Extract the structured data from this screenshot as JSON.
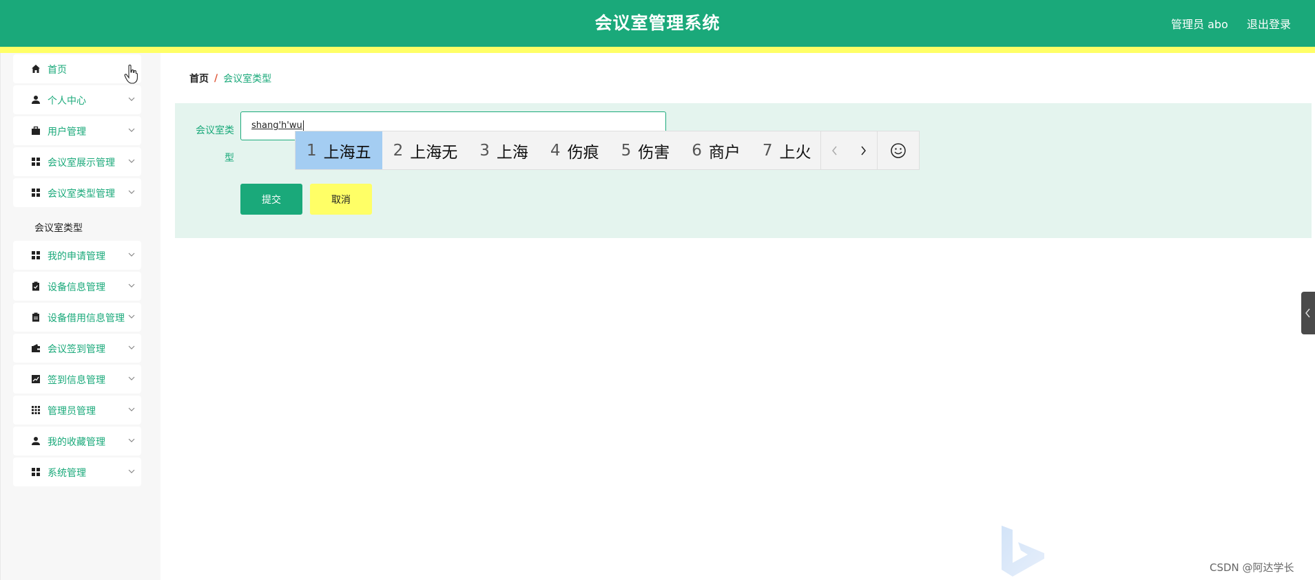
{
  "header": {
    "title": "会议室管理系统",
    "user_label": "管理员 abo",
    "logout_label": "退出登录",
    "bg_color": "#1aa97a",
    "stripe_color": "#ffff66"
  },
  "sidebar": {
    "items": [
      {
        "label": "首页",
        "icon": "home-icon"
      },
      {
        "label": "个人中心",
        "icon": "user-icon"
      },
      {
        "label": "用户管理",
        "icon": "briefcase-icon"
      },
      {
        "label": "会议室展示管理",
        "icon": "grid-icon"
      },
      {
        "label": "会议室类型管理",
        "icon": "grid-icon"
      },
      {
        "label": "我的申请管理",
        "icon": "grid-icon"
      },
      {
        "label": "设备信息管理",
        "icon": "clipboard-check-icon"
      },
      {
        "label": "设备借用信息管理",
        "icon": "clipboard-icon"
      },
      {
        "label": "会议签到管理",
        "icon": "wallet-icon"
      },
      {
        "label": "签到信息管理",
        "icon": "chart-icon"
      },
      {
        "label": "管理员管理",
        "icon": "apps-icon"
      },
      {
        "label": "我的收藏管理",
        "icon": "user-tie-icon"
      },
      {
        "label": "系统管理",
        "icon": "grid-icon"
      }
    ],
    "sub_item": "会议室类型"
  },
  "breadcrumb": {
    "home": "首页",
    "separator": "/",
    "current": "会议室类型"
  },
  "form": {
    "label_line1": "会议室类",
    "label_line2": "型",
    "input_value": "shang'h'wu",
    "submit_label": "提交",
    "cancel_label": "取消"
  },
  "ime": {
    "candidates": [
      {
        "num": "1",
        "text": "上海五"
      },
      {
        "num": "2",
        "text": "上海无"
      },
      {
        "num": "3",
        "text": "上海"
      },
      {
        "num": "4",
        "text": "伤痕"
      },
      {
        "num": "5",
        "text": "伤害"
      },
      {
        "num": "6",
        "text": "商户"
      },
      {
        "num": "7",
        "text": "上火"
      }
    ],
    "selected_index": 0,
    "emoji": "☺"
  },
  "watermark": {
    "text": "CSDN @阿达学长"
  }
}
